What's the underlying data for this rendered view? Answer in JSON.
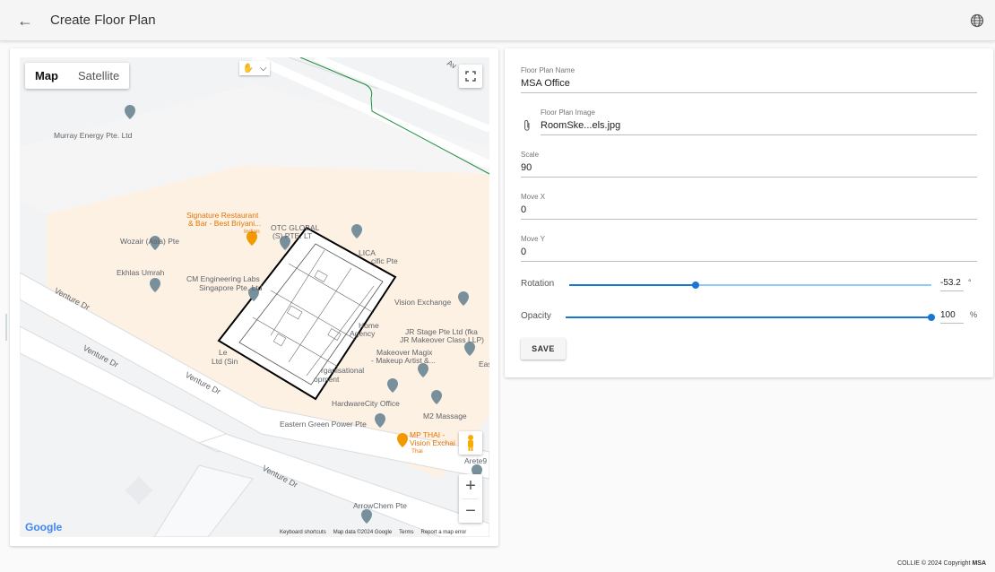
{
  "header": {
    "title": "Create Floor Plan",
    "back_icon": "arrow-left-icon",
    "lang_icon": "globe-icon"
  },
  "map": {
    "type_buttons": [
      "Map",
      "Satellite"
    ],
    "labels": {
      "murray": "Murray Energy Pte. Ltd",
      "signature": "Signature Restaurant",
      "signature2": "& Bar - Best Briyani...",
      "indian": "Indian",
      "otc": "OTC GLOBAL",
      "otc2": "(S) PTE. LT",
      "lica": "LICA",
      "pacific": "cific Pte",
      "wozair": "Wozair (Asia) Pte",
      "ekhlas": "Ekhlas Umrah",
      "cm": "CM Engineering Labs",
      "cm2": "Singapore Pte. Ltd",
      "vision": "Vision Exchange",
      "home": "Home",
      "agency": "Agency",
      "jr": "JR Stage Pte Ltd (fka",
      "jr2": "JR Makeover Class LLP)",
      "makeover": "Makeover Magix",
      "makeover2": "- Makeup Artist &...",
      "eas": "Eas",
      "le": "Le",
      "ltd": "Ltd (Sin",
      "organisational": "rganisational",
      "opment": "opment",
      "hwcity": "HardwareCity Office",
      "m2": "M2 Massage",
      "egp": "Eastern Green Power Pte",
      "mpthai": "MP THAI -",
      "mpthai2": "Vision Exchai",
      "thai": "Thai",
      "arete": "Arete9",
      "arrowchem": "ArrowChem Pte",
      "road1": "Venture Dr",
      "road2": "Venture Dr",
      "road3": "Venture Dr",
      "road4": "Venture Dr",
      "av": "Av"
    },
    "attribution": [
      "Keyboard shortcuts",
      "Map data ©2024 Google",
      "Terms",
      "Report a map error"
    ],
    "google": "Google",
    "zoom_in": "+",
    "zoom_out": "−"
  },
  "form": {
    "name_label": "Floor Plan Name",
    "name_value": "MSA Office",
    "image_label": "Floor Plan Image",
    "image_value": "RoomSke...els.jpg",
    "scale_label": "Scale",
    "scale_value": "90",
    "movex_label": "Move X",
    "movex_value": "0",
    "movey_label": "Move Y",
    "movey_value": "0",
    "rotation_label": "Rotation",
    "rotation_value": "-53.2",
    "rotation_unit": "°",
    "rotation_fraction": 0.35,
    "opacity_label": "Opacity",
    "opacity_value": "100",
    "opacity_unit": "%",
    "opacity_fraction": 1.0,
    "save_label": "SAVE"
  },
  "footer": {
    "text": "COLLIE © 2024 Copyright ",
    "brand": "MSA"
  }
}
